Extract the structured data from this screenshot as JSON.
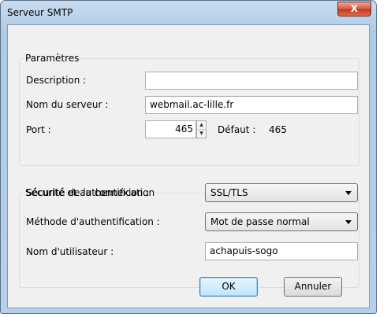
{
  "window": {
    "title": "Serveur SMTP",
    "close_glyph": "X"
  },
  "params": {
    "legend": "Paramètres",
    "description_label": "Description :",
    "description_value": "",
    "server_label": "Nom du serveur :",
    "server_value": "webmail.ac-lille.fr",
    "port_label": "Port :",
    "port_value": "465",
    "default_label": "Défaut :",
    "default_value": "465"
  },
  "security": {
    "legend": "Sécurité et authentification",
    "connection_label": "Sécurité de la connexion :",
    "connection_value": "SSL/TLS",
    "auth_label": "Méthode d'authentification :",
    "auth_value": "Mot de passe normal",
    "user_label": "Nom d'utilisateur :",
    "user_value": "achapuis-sogo"
  },
  "buttons": {
    "ok": "OK",
    "cancel": "Annuler"
  }
}
